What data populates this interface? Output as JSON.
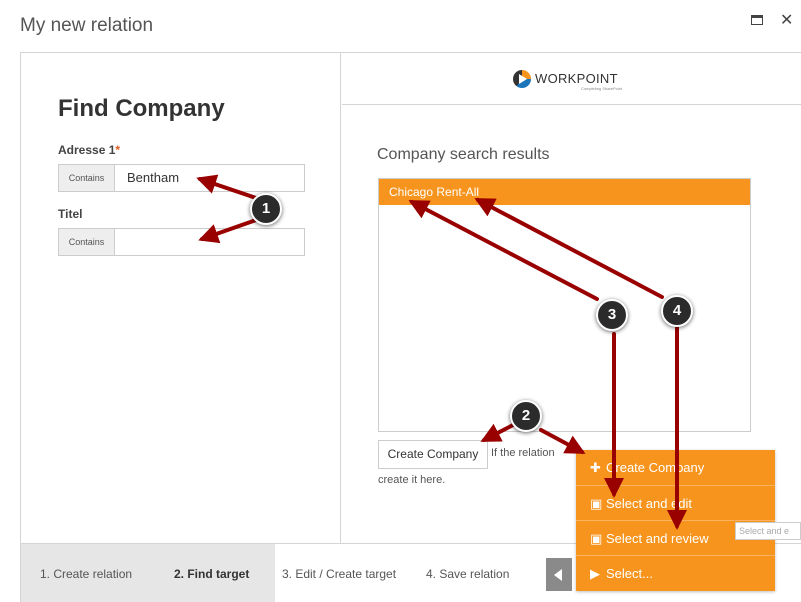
{
  "dialog": {
    "title": "My new relation",
    "maximize_icon": "maximize-icon",
    "close_icon": "close-icon",
    "close_glyph": "✕"
  },
  "left": {
    "heading": "Find Company",
    "fields": [
      {
        "label": "Adresse 1",
        "required_mark": "*",
        "prefix": "Contains",
        "value": "Bentham"
      },
      {
        "label": "Titel",
        "prefix": "Contains",
        "value": ""
      }
    ]
  },
  "right": {
    "logo_text": "WORKPOINT",
    "logo_tagline": "Completing SharePoint",
    "results_title": "Company search results",
    "results": [
      "Chicago Rent-All"
    ],
    "create_button": "Create Company",
    "hint_line1": "If the relation",
    "hint_line2": "create it here."
  },
  "footer": {
    "steps": [
      "1. Create relation",
      "2. Find target",
      "3. Edit / Create target",
      "4. Save relation"
    ],
    "active_step": 2
  },
  "menu": {
    "items": [
      {
        "label": "Create Company",
        "icon": "plus-icon",
        "glyph": "✚"
      },
      {
        "label": "Select and edit",
        "icon": "save-icon",
        "glyph": "▣"
      },
      {
        "label": "Select and review",
        "icon": "save-review-icon",
        "glyph": "▣"
      },
      {
        "label": "Select...",
        "icon": "play-icon",
        "glyph": "▶"
      }
    ]
  },
  "tooltip": "Select and e",
  "annotations": {
    "badges": [
      "1",
      "2",
      "3",
      "4"
    ],
    "colors": {
      "arrow": "#990000",
      "badge": "#2b2b2b"
    }
  },
  "colors": {
    "accent": "#f7941d",
    "step_bg": "#e6e6e6"
  }
}
